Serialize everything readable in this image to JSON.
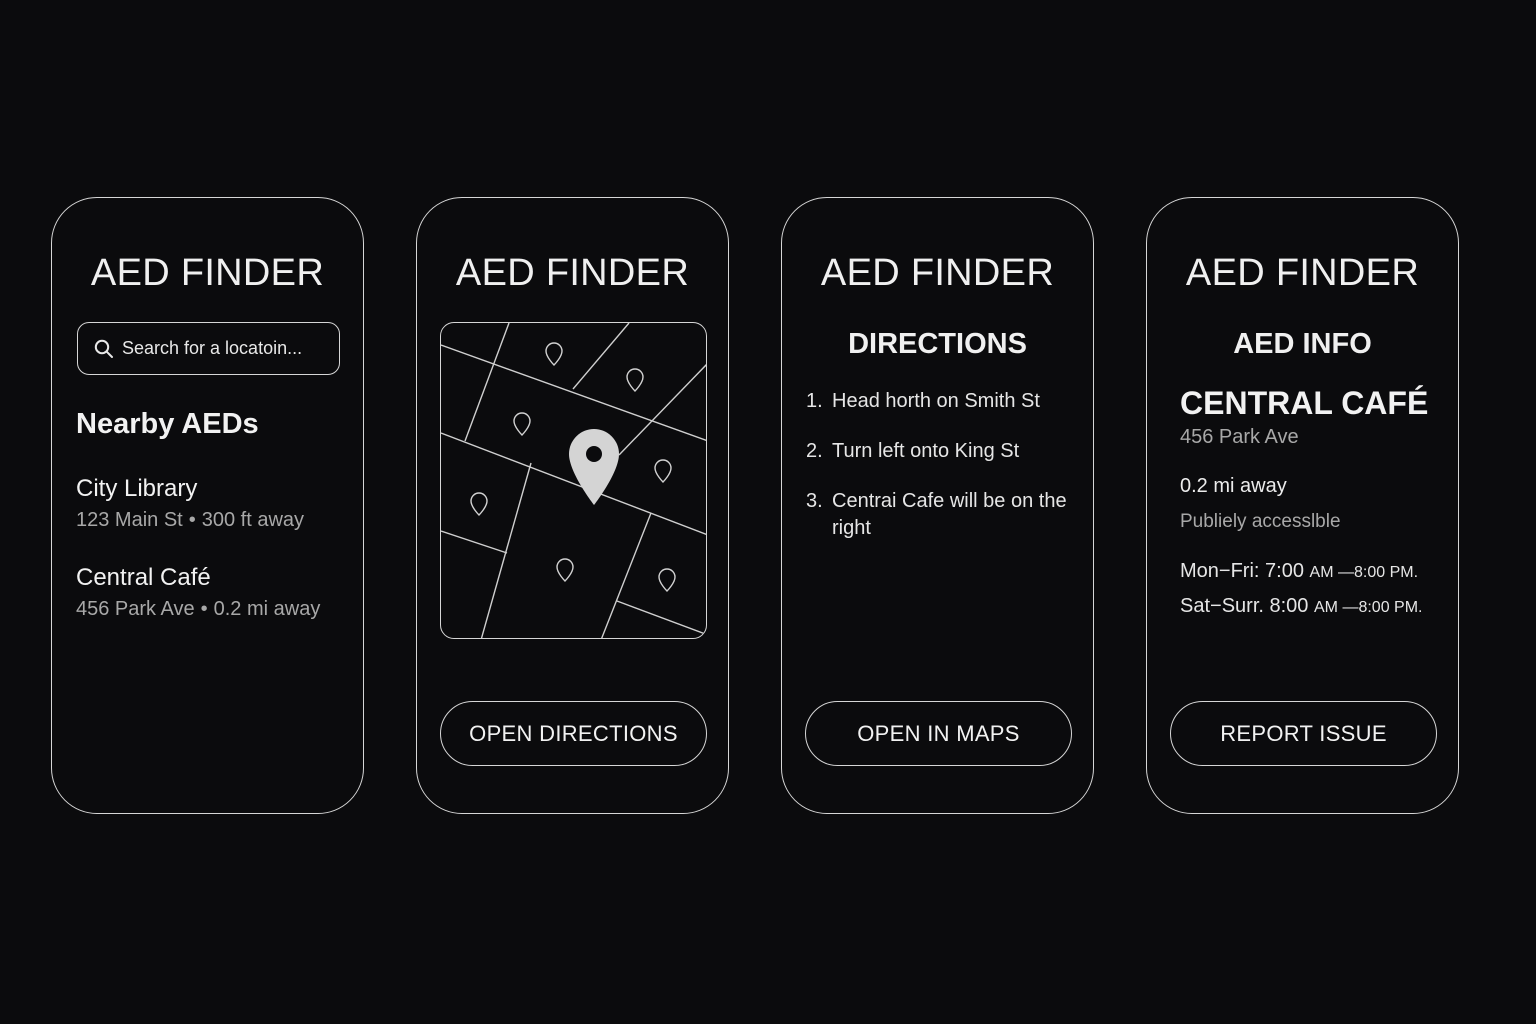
{
  "app_title": "AED FINDER",
  "screen1": {
    "search_placeholder": "Search for a locatoin...",
    "section_title": "Nearby AEDs",
    "items": [
      {
        "name": "City Library",
        "address": "123 Main St",
        "distance": "300 ft away"
      },
      {
        "name": "Central Café",
        "address": "456 Park Ave",
        "distance": "0.2 mi away"
      }
    ],
    "separator": "•"
  },
  "screen2": {
    "button_label": "OPEN DIRECTIONS"
  },
  "screen3": {
    "subtitle": "DIRECTIONS",
    "steps": [
      {
        "num": "1.",
        "text": "Head horth on Smith St"
      },
      {
        "num": "2.",
        "text": "Turn left onto King St"
      },
      {
        "num": "3.",
        "text": "Centrai Cafe will be on the right"
      }
    ],
    "button_label": "OPEN IN MAPS"
  },
  "screen4": {
    "subtitle": "AED INFO",
    "venue": "CENTRAL CAFÉ",
    "address": "456 Park Ave",
    "distance": "0.2 mi away",
    "access": "Publiely accesslble",
    "hours": [
      {
        "days": "Mon−Fri:",
        "open": "7:00",
        "rest": "AM —8:00 PM."
      },
      {
        "days": "Sat−Surr.",
        "open": "8:00",
        "rest": "AM —8:00 PM."
      }
    ],
    "button_label": "REPORT ISSUE"
  },
  "icons": {
    "search": "search-icon",
    "selected_pin": "location-pin-icon",
    "pins": "map-pin-icon"
  },
  "colors": {
    "background": "#0b0b0d",
    "outline": "#d6d6d6",
    "text_primary": "#f2f2f2",
    "text_secondary": "#a8a8a8"
  }
}
